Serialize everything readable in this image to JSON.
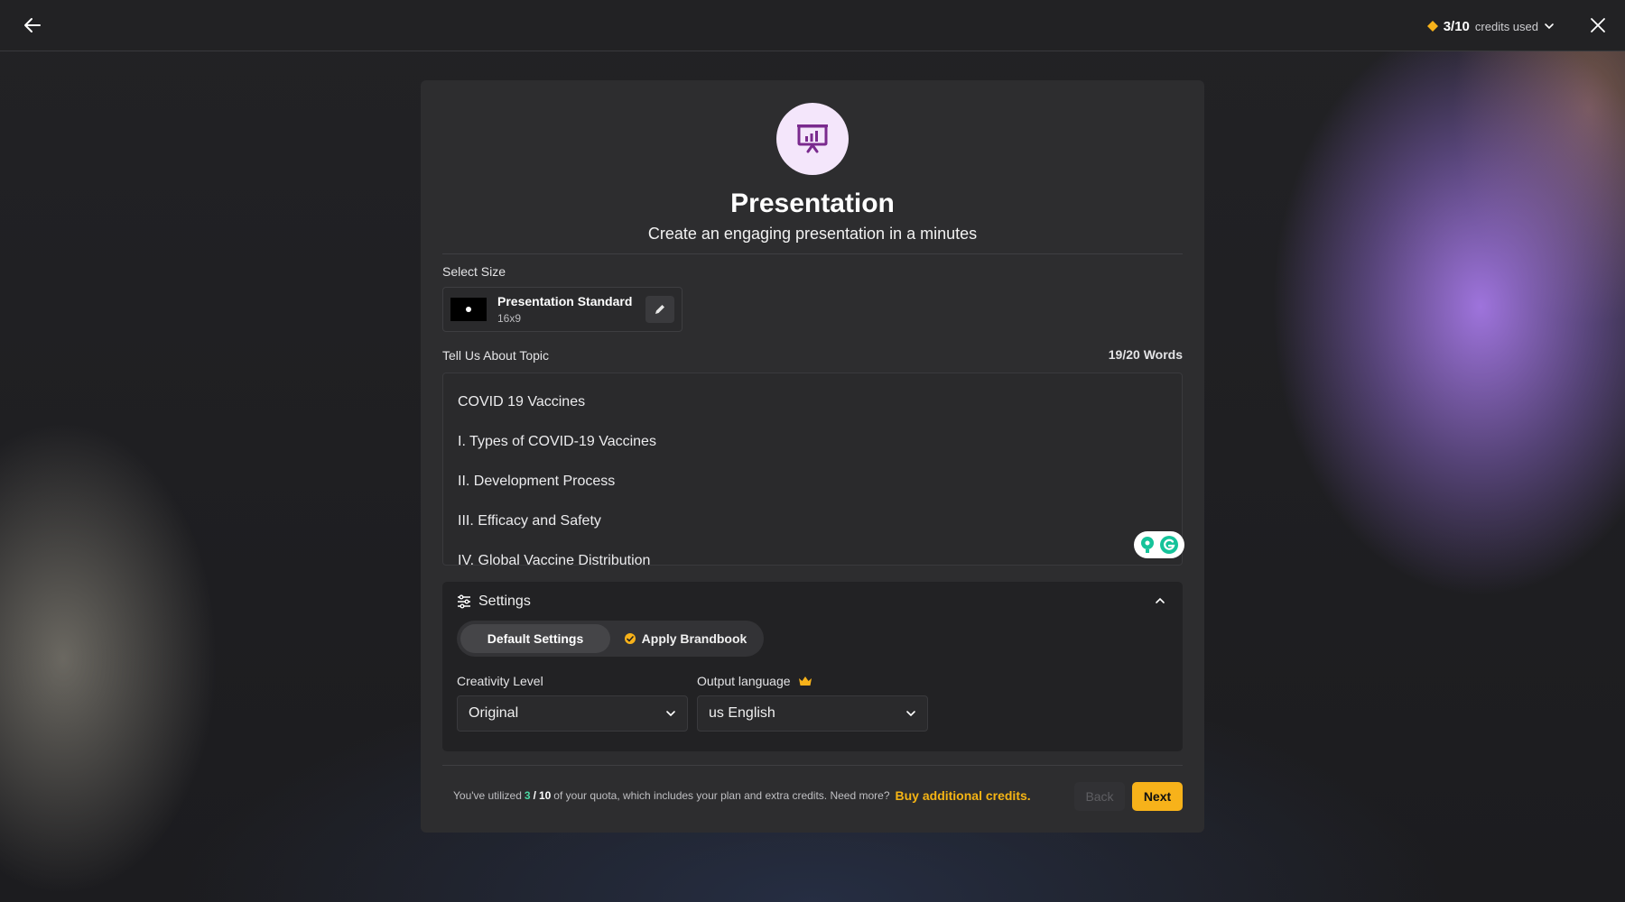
{
  "topbar": {
    "credits_count": "3/10",
    "credits_label": "credits used"
  },
  "card": {
    "title": "Presentation",
    "subtitle": "Create an engaging presentation in a minutes"
  },
  "size": {
    "section_label": "Select Size",
    "name": "Presentation Standard",
    "ratio": "16x9"
  },
  "topic": {
    "label": "Tell Us About Topic",
    "word_count": "19/20 Words",
    "lines": [
      "COVID 19 Vaccines",
      "I. Types of COVID-19 Vaccines",
      "II. Development Process",
      "III. Efficacy and Safety",
      "IV. Global Vaccine Distribution"
    ]
  },
  "settings": {
    "title": "Settings",
    "tabs": [
      "Default Settings",
      "Apply Brandbook"
    ],
    "creativity_label": "Creativity Level",
    "creativity_value": "Original",
    "language_label": "Output language",
    "language_value": "us English"
  },
  "footer": {
    "prefix": "You've utilized",
    "used": "3",
    "sep": "/",
    "total": "10",
    "suffix": "of your quota, which includes your plan and extra credits. Need more?",
    "buy_link": "Buy additional credits.",
    "back_button": "Back",
    "next_button": "Next"
  },
  "colors": {
    "accent": "#f7b21a",
    "icon_bg": "#f4e6fb",
    "icon_fg": "#7a2a8e",
    "quota_green": "#4ad7a3"
  },
  "icons": [
    "back-arrow-icon",
    "diamond-icon",
    "chevron-down-icon",
    "close-icon",
    "presentation-icon",
    "pencil-icon",
    "grammarly-icon",
    "sliders-icon",
    "chevron-up-icon",
    "brandbook-icon",
    "crown-icon"
  ]
}
